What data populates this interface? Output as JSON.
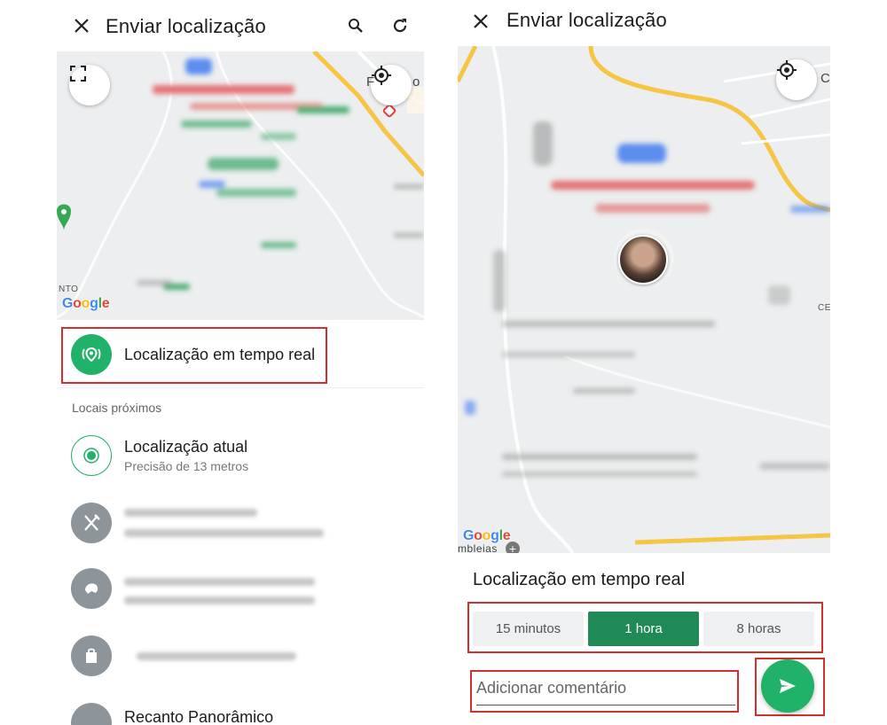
{
  "left_screen": {
    "title": "Enviar localização",
    "icons": {
      "close": "close-icon",
      "search": "search-icon",
      "refresh": "refresh-icon",
      "fullscreen": "fullscreen-icon",
      "my_location": "my-location-icon"
    },
    "map": {
      "google_logo": "Google",
      "label_left": "NTO",
      "label_top": "F",
      "label_top2": "o"
    },
    "live_location": {
      "label": "Localização em tempo real",
      "icon": "live-location-icon",
      "color": "#21b26a"
    },
    "nearby_header": "Locais próximos",
    "current_location": {
      "title": "Localização atual",
      "subtitle": "Precisão de 13 metros"
    },
    "places": [
      {
        "icon": "restaurant-icon"
      },
      {
        "icon": "bakery-icon"
      },
      {
        "icon": "shopping-icon"
      }
    ],
    "partial_item": "Recanto Panorâmico"
  },
  "right_screen": {
    "title": "Enviar localização",
    "icons": {
      "close": "close-icon",
      "my_location": "my-location-icon",
      "send": "send-icon"
    },
    "map": {
      "google_logo": "Google",
      "label_bottom": "mbleias",
      "label_right_top": "C",
      "label_right_mid": "CE"
    },
    "live_location_header": "Localização em tempo real",
    "durations": [
      {
        "label": "15 minutos",
        "selected": false
      },
      {
        "label": "1 hora",
        "selected": true
      },
      {
        "label": "8 horas",
        "selected": false
      }
    ],
    "comment_placeholder": "Adicionar comentário",
    "accent_color": "#1f8a56",
    "fab_color": "#21b26a"
  }
}
